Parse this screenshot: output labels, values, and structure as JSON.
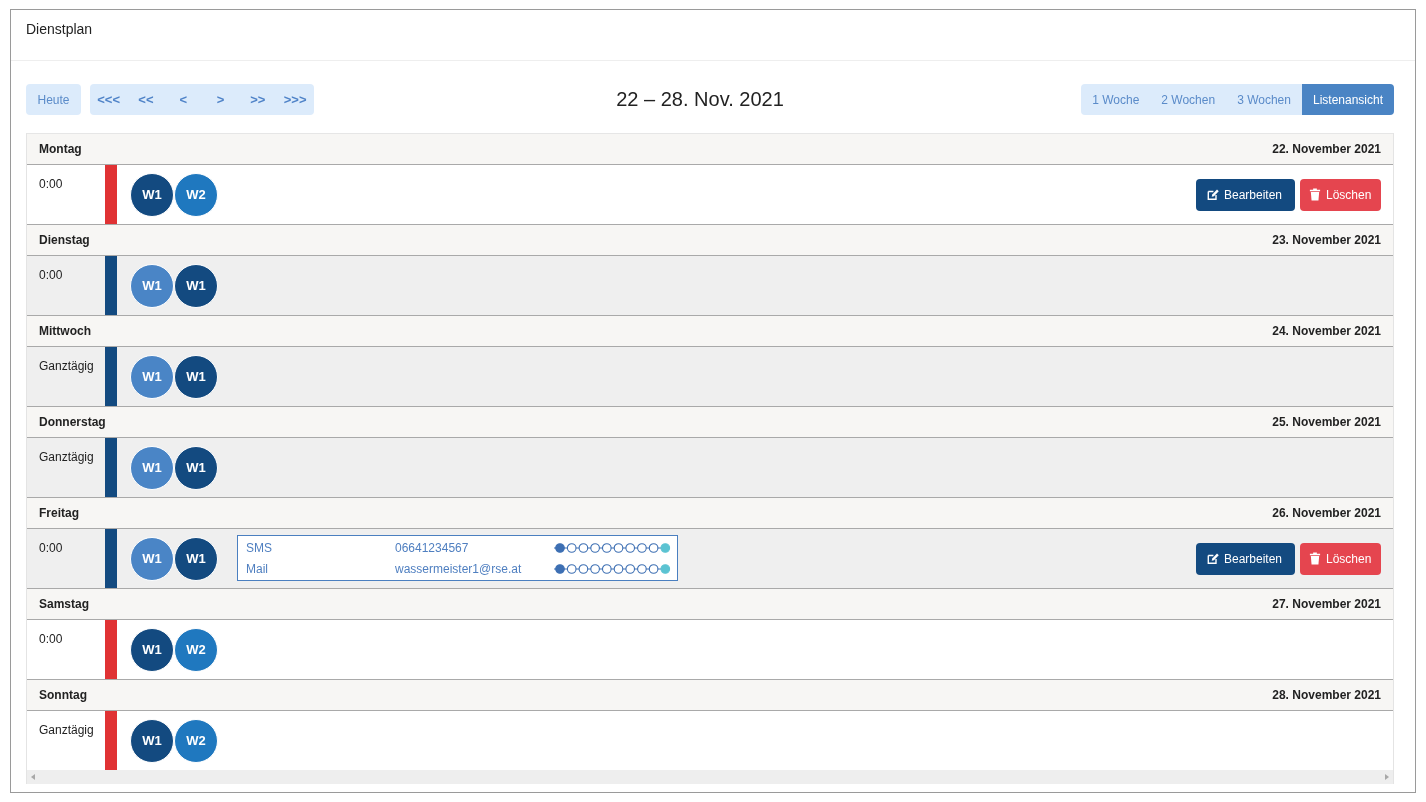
{
  "header": {
    "title": "Dienstplan"
  },
  "toolbar": {
    "today_button": "Heute",
    "nav_buttons": [
      "<<<",
      "<<",
      "<",
      ">",
      ">>",
      ">>>"
    ],
    "date_range": "22 – 28. Nov. 2021",
    "views": [
      {
        "label": "1 Woche",
        "selected": false
      },
      {
        "label": "2 Wochen",
        "selected": false
      },
      {
        "label": "3 Wochen",
        "selected": false
      },
      {
        "label": "Listenansicht",
        "selected": true
      }
    ]
  },
  "days": [
    {
      "name": "Montag",
      "date": "22. November 2021",
      "events": [
        {
          "time": "0:00",
          "color": "#e03234",
          "shaded": false,
          "badges": [
            {
              "label": "W1",
              "color": "#134a80"
            },
            {
              "label": "W2",
              "color": "#1f78bf"
            }
          ],
          "actions": [
            {
              "kind": "edit",
              "label": "Bearbeiten"
            },
            {
              "kind": "delete",
              "label": "Löschen"
            }
          ]
        }
      ]
    },
    {
      "name": "Dienstag",
      "date": "23. November 2021",
      "events": [
        {
          "time": "0:00",
          "color": "#134a80",
          "shaded": true,
          "badges": [
            {
              "label": "W1",
              "color": "#4a85c6"
            },
            {
              "label": "W1",
              "color": "#134a80"
            }
          ]
        }
      ]
    },
    {
      "name": "Mittwoch",
      "date": "24. November 2021",
      "events": [
        {
          "time": "Ganztägig",
          "color": "#134a80",
          "shaded": true,
          "badges": [
            {
              "label": "W1",
              "color": "#4a85c6"
            },
            {
              "label": "W1",
              "color": "#134a80"
            }
          ]
        }
      ]
    },
    {
      "name": "Donnerstag",
      "date": "25. November 2021",
      "events": [
        {
          "time": "Ganztägig",
          "color": "#134a80",
          "shaded": true,
          "badges": [
            {
              "label": "W1",
              "color": "#4a85c6"
            },
            {
              "label": "W1",
              "color": "#134a80"
            }
          ]
        }
      ]
    },
    {
      "name": "Freitag",
      "date": "26. November 2021",
      "events": [
        {
          "time": "0:00",
          "color": "#134a80",
          "shaded": true,
          "badges": [
            {
              "label": "W1",
              "color": "#4a85c6"
            },
            {
              "label": "W1",
              "color": "#134a80"
            }
          ],
          "contacts": [
            {
              "channel": "SMS",
              "address": "06641234567"
            },
            {
              "channel": "Mail",
              "address": "wassermeister1@rse.at"
            }
          ],
          "actions": [
            {
              "kind": "edit",
              "label": "Bearbeiten"
            },
            {
              "kind": "delete",
              "label": "Löschen"
            }
          ]
        }
      ]
    },
    {
      "name": "Samstag",
      "date": "27. November 2021",
      "events": [
        {
          "time": "0:00",
          "color": "#e03234",
          "shaded": false,
          "badges": [
            {
              "label": "W1",
              "color": "#134a80"
            },
            {
              "label": "W2",
              "color": "#1f78bf"
            }
          ]
        }
      ]
    },
    {
      "name": "Sonntag",
      "date": "28. November 2021",
      "events": [
        {
          "time": "Ganztägig",
          "color": "#e03234",
          "shaded": false,
          "badges": [
            {
              "label": "W1",
              "color": "#134a80"
            },
            {
              "label": "W2",
              "color": "#1f78bf"
            }
          ]
        }
      ]
    }
  ]
}
